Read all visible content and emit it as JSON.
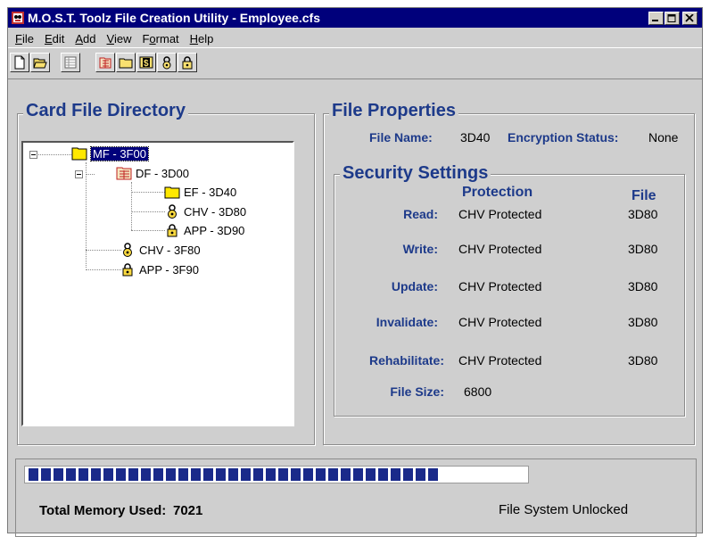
{
  "window": {
    "title": "M.O.S.T. Toolz File Creation Utility - Employee.cfs"
  },
  "menu": [
    {
      "label": "File",
      "key": "F",
      "rest": "ile"
    },
    {
      "label": "Edit",
      "key": "E",
      "rest": "dit"
    },
    {
      "label": "Add",
      "key": "A",
      "rest": "dd"
    },
    {
      "label": "View",
      "key": "V",
      "rest": "iew"
    },
    {
      "label": "Format",
      "key": "o",
      "pre": "F",
      "rest": "rmat"
    },
    {
      "label": "Help",
      "key": "H",
      "rest": "elp"
    }
  ],
  "toolbar": {
    "icons": [
      "new-file-icon",
      "open-folder-icon",
      "table-icon",
      "df-file-icon",
      "ef-folder-icon",
      "dollar-icon",
      "chv-lock-icon",
      "app-lock-icon"
    ]
  },
  "directory": {
    "title": "Card File Directory",
    "nodes": {
      "mf": "MF - 3F00",
      "df": "DF - 3D00",
      "ef": "EF - 3D40",
      "chv_df": "CHV - 3D80",
      "app_df": "APP - 3D90",
      "chv_mf": "CHV - 3F80",
      "app_mf": "APP - 3F90"
    }
  },
  "properties": {
    "title": "File Properties",
    "file_name_label": "File Name:",
    "file_name": "3D40",
    "encryption_label": "Encryption Status:",
    "encryption": "None"
  },
  "security": {
    "title": "Security Settings",
    "protection_header": "Protection",
    "file_header": "File",
    "rows": [
      {
        "label": "Read:",
        "protection": "CHV Protected",
        "file": "3D80"
      },
      {
        "label": "Write:",
        "protection": "CHV Protected",
        "file": "3D80"
      },
      {
        "label": "Update:",
        "protection": "CHV Protected",
        "file": "3D80"
      },
      {
        "label": "Invalidate:",
        "protection": "CHV Protected",
        "file": "3D80"
      },
      {
        "label": "Rehabilitate:",
        "protection": "CHV Protected",
        "file": "3D80"
      }
    ],
    "file_size_label": "File Size:",
    "file_size": "6800"
  },
  "status": {
    "memory_label": "Total Memory Used:",
    "memory_value": "7021",
    "lock_status": "File System Unlocked",
    "progress_fraction": 0.84,
    "progress_color": "#1a2a8a"
  }
}
